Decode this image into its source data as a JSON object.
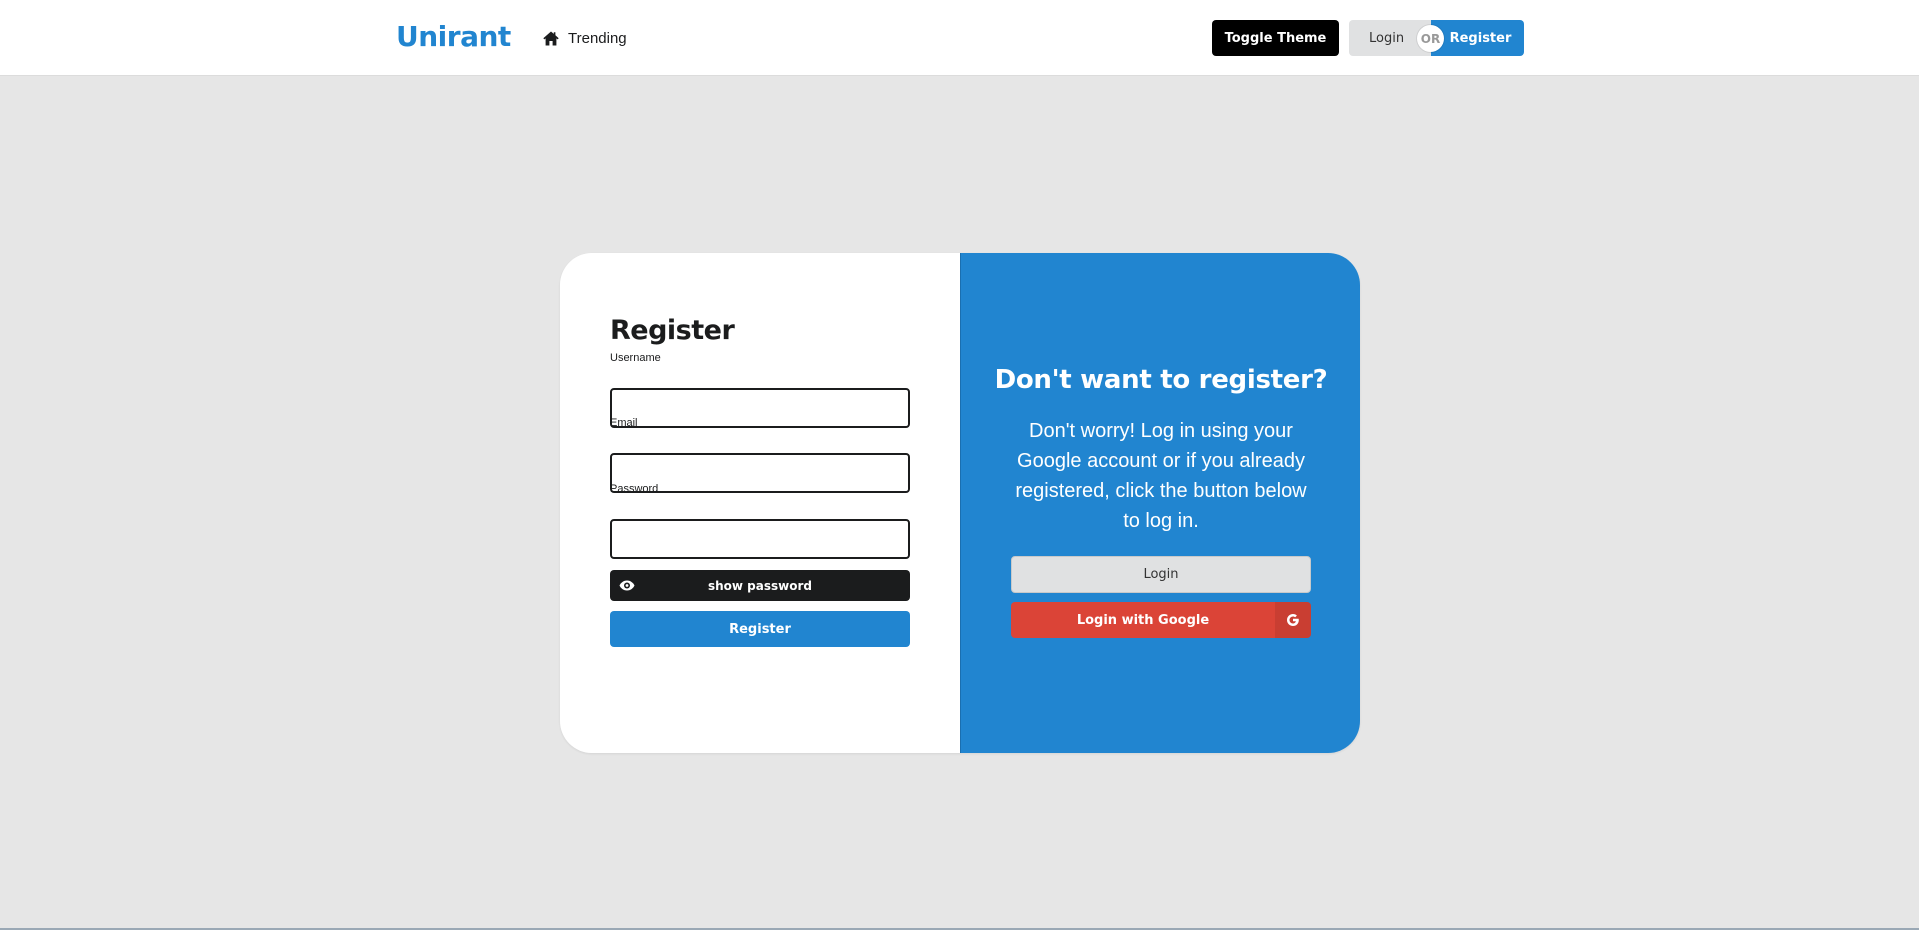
{
  "header": {
    "brand": "Unirant",
    "nav_trending": "Trending",
    "toggle_theme": "Toggle Theme",
    "login": "Login",
    "or": "OR",
    "register": "Register"
  },
  "register_form": {
    "title": "Register",
    "username_label": "Username",
    "username_value": "",
    "email_label": "Email",
    "email_value": "",
    "password_label": "Password",
    "password_value": "",
    "show_password": "show password",
    "submit": "Register"
  },
  "promo": {
    "title": "Don't want to register?",
    "text": "Don't worry! Log in using your Google account or if you already registered, click the button below to log in.",
    "login_button": "Login",
    "google_button": "Login with Google"
  },
  "icons": {
    "trending": "home-icon",
    "show_password": "eye-icon",
    "google": "google-icon"
  },
  "colors": {
    "brand": "#2185d0",
    "google": "#db4437",
    "dark": "#1b1c1d",
    "background": "#e6e6e6"
  }
}
